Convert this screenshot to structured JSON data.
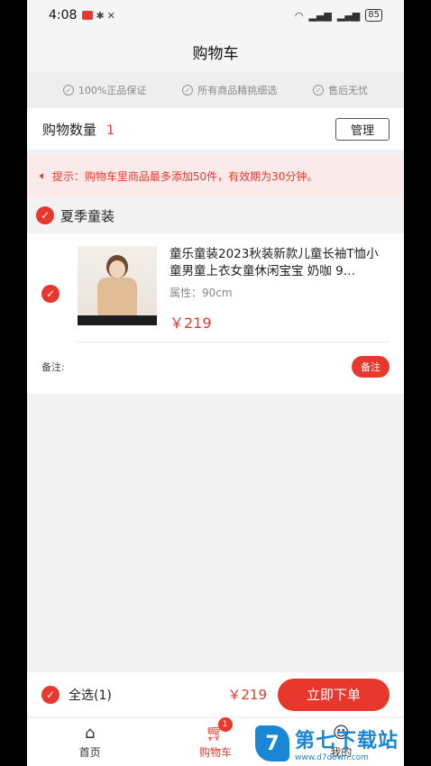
{
  "status": {
    "time": "4:08",
    "battery": "85"
  },
  "nav": {
    "title": "购物车"
  },
  "guarantees": [
    "100%正品保证",
    "所有商品精挑细选",
    "售后无忧"
  ],
  "cart_count": {
    "label": "购物数量",
    "value": "1",
    "manage_label": "管理"
  },
  "tip": {
    "text": "提示：购物车里商品最多添加50件，有效期为30分钟。"
  },
  "shop": {
    "name": "夏季童装"
  },
  "product": {
    "title": "童乐童装2023秋装新款儿童长袖T恤小童男童上衣女童休闲宝宝 奶咖 9…",
    "attr": "属性：90cm",
    "price": "￥219",
    "note_label": "备注:",
    "note_button": "备注"
  },
  "checkout": {
    "select_all": "全选(1)",
    "total": "￥219",
    "order_button": "立即下单"
  },
  "tabs": [
    {
      "label": "首页",
      "icon": "home-icon"
    },
    {
      "label": "购物车",
      "icon": "cart-icon",
      "badge": "1"
    },
    {
      "label": "我的",
      "icon": "user-icon"
    }
  ],
  "watermark": {
    "title": "第七下载站",
    "url": "www.d7down.com"
  },
  "colors": {
    "accent": "#e8382d",
    "watermark": "#1a86d6"
  }
}
